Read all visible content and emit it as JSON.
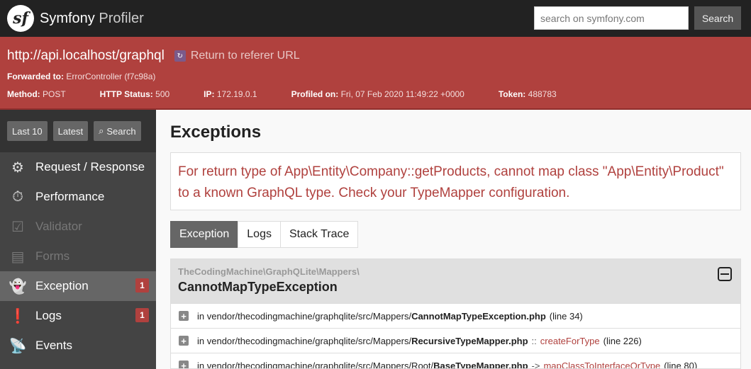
{
  "header": {
    "logo_glyph": "sf",
    "brand_main": "Symfony",
    "brand_sub": "Profiler",
    "search_placeholder": "search on symfony.com",
    "search_button": "Search"
  },
  "summary": {
    "url": "http://api.localhost/graphql",
    "referer_label": "Return to referer URL",
    "forwarded_label": "Forwarded to:",
    "forwarded_value": "ErrorController (f7c98a)",
    "method_label": "Method:",
    "method_value": "POST",
    "status_label": "HTTP Status:",
    "status_value": "500",
    "ip_label": "IP:",
    "ip_value": "172.19.0.1",
    "profiled_label": "Profiled on:",
    "profiled_value": "Fri, 07 Feb 2020 11:49:22 +0000",
    "token_label": "Token:",
    "token_value": "488783"
  },
  "sidebar": {
    "buttons": {
      "last10": "Last 10",
      "latest": "Latest",
      "search": "Search"
    },
    "items": [
      {
        "label": "Request / Response",
        "icon": "gears-icon"
      },
      {
        "label": "Performance",
        "icon": "stopwatch-icon"
      },
      {
        "label": "Validator",
        "icon": "checkbox-icon"
      },
      {
        "label": "Forms",
        "icon": "form-icon"
      },
      {
        "label": "Exception",
        "icon": "ghost-icon",
        "badge": "1"
      },
      {
        "label": "Logs",
        "icon": "alert-icon",
        "badge": "1"
      },
      {
        "label": "Events",
        "icon": "broadcast-icon"
      }
    ]
  },
  "main": {
    "title": "Exceptions",
    "message": "For return type of App\\Entity\\Company::getProducts, cannot map class \"App\\Entity\\Product\" to a known GraphQL type. Check your TypeMapper configuration.",
    "tabs": [
      "Exception",
      "Logs",
      "Stack Trace"
    ],
    "exception": {
      "namespace": "TheCodingMachine\\GraphQLite\\Mappers\\",
      "class": "CannotMapTypeException"
    },
    "trace": [
      {
        "prefix": "in vendor/thecodingmachine/graphqlite/src/Mappers/",
        "file": "CannotMapTypeException.php",
        "sep": "",
        "fn": "",
        "line": "(line 34)"
      },
      {
        "prefix": "in vendor/thecodingmachine/graphqlite/src/Mappers/",
        "file": "RecursiveTypeMapper.php",
        "sep": "::",
        "fn": "createForType",
        "line": "(line 226)"
      },
      {
        "prefix": "in vendor/thecodingmachine/graphqlite/src/Mappers/Root/",
        "file": "BaseTypeMapper.php",
        "sep": "->",
        "fn": "mapClassToInterfaceOrType",
        "line": "(line 80)"
      }
    ]
  }
}
